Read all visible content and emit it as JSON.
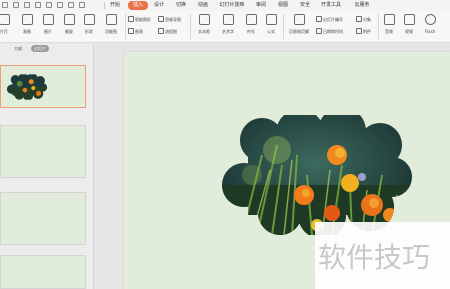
{
  "menubar": {
    "tabs": [
      "开始",
      "插入",
      "设计",
      "切换",
      "动画",
      "幻灯片放映",
      "审阅",
      "视图",
      "安全",
      "开发工具",
      "云服务"
    ],
    "active_tab": "插入",
    "accent": "#e8734a"
  },
  "ribbon": {
    "cut_label": "片打",
    "table_label": "表格",
    "picture_label": "图片",
    "screenshot_label": "截屏",
    "shape_label": "形状",
    "function_label": "功能图",
    "smartart_label": "智能图形",
    "chart_label": "图表",
    "online_chart_label": "思维导图",
    "flowchart_label": "流程图",
    "textbox_label": "文本框",
    "wordart_label": "艺术字",
    "symbol_label": "符号",
    "formula_label": "公式",
    "header_footer_label": "页眉和页脚",
    "slide_number_label": "幻灯片编号",
    "datetime_label": "日期和时间",
    "object_label": "对象",
    "attachment_label": "附件",
    "audio_label": "音频",
    "video_label": "视频",
    "flash_label": "Flash"
  },
  "leftpanel": {
    "outline_label": "大纲",
    "slides_label": "幻灯片"
  },
  "watermark": {
    "text": "软件技巧"
  },
  "colors": {
    "slide_bg": "#e1edda",
    "flower_orange": "#f08a1c"
  }
}
